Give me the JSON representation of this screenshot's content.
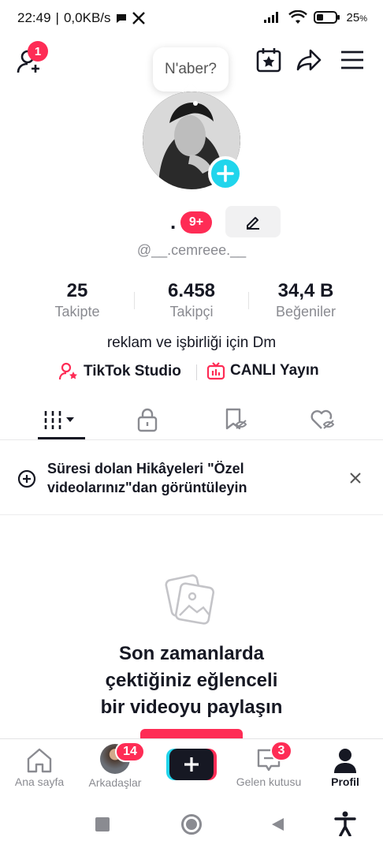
{
  "status_bar": {
    "time": "22:49",
    "net_speed": "0,0KB/s",
    "battery_percent": "25",
    "battery_unit": "%"
  },
  "header": {
    "notification_count": "1",
    "note_bubble": "N'aber?"
  },
  "profile": {
    "display_name": ".",
    "name_badge": "9+",
    "username": "@__.cemreee.__",
    "bio": "reklam ve işbirliği için Dm"
  },
  "stats": [
    {
      "value": "25",
      "label": "Takipte"
    },
    {
      "value": "6.458",
      "label": "Takipçi"
    },
    {
      "value": "34,4 B",
      "label": "Beğeniler"
    }
  ],
  "links": {
    "studio": "TikTok Studio",
    "live": "CANLI Yayın"
  },
  "banner": {
    "text_line1": "Süresi dolan Hikâyeleri \"Özel",
    "text_line2": "videolarınız\"dan görüntüleyin"
  },
  "empty_state": {
    "line1": "Son zamanlarda",
    "line2": "çektiğiniz eğlenceli",
    "line3": "bir videoyu paylaşın"
  },
  "bottom_nav": {
    "home": "Ana sayfa",
    "friends": "Arkadaşlar",
    "friends_badge": "14",
    "inbox": "Gelen kutusu",
    "inbox_badge": "3",
    "profile": "Profil"
  },
  "colors": {
    "accent": "#fe2c55",
    "cyan": "#20d5ec",
    "text": "#161823",
    "muted": "#8a8b91"
  }
}
